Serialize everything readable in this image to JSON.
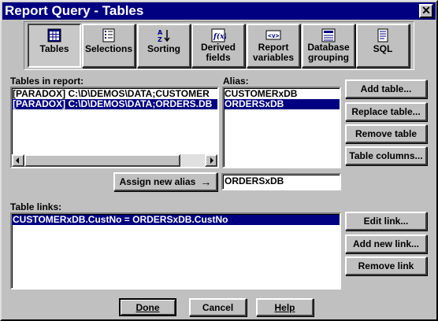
{
  "window": {
    "title": "Report Query - Tables",
    "close_glyph": "✕"
  },
  "toolbar": [
    {
      "label": "Tables",
      "icon": "table-grid-icon",
      "pressed": true
    },
    {
      "label": "Selections",
      "icon": "selection-list-icon"
    },
    {
      "label": "Sorting",
      "icon": "sort-az-icon"
    },
    {
      "label": "Derived\nfields",
      "icon": "formula-icon"
    },
    {
      "label": "Report\nvariables",
      "icon": "variable-icon"
    },
    {
      "label": "Database\ngrouping",
      "icon": "database-grouping-icon"
    },
    {
      "label": "SQL",
      "icon": "sql-document-icon"
    }
  ],
  "tables": {
    "label": "Tables in report:",
    "rows": [
      "[PARADOX] C:\\D\\DEMOS\\DATA;CUSTOMER",
      "[PARADOX] C:\\D\\DEMOS\\DATA;ORDERS.DB"
    ]
  },
  "alias": {
    "label": "Alias:",
    "rows": [
      "CUSTOMERxDB",
      "ORDERSxDB"
    ],
    "input_value": "ORDERSxDB"
  },
  "table_buttons": {
    "add": "Add table...",
    "replace": "Replace table...",
    "remove": "Remove table",
    "columns": "Table columns..."
  },
  "assign_button": "Assign new alias",
  "assign_arrow": "→",
  "links": {
    "label": "Table links:",
    "rows": [
      "CUSTOMERxDB.CustNo = ORDERSxDB.CustNo"
    ]
  },
  "link_buttons": {
    "edit": "Edit link...",
    "add": "Add new link...",
    "remove": "Remove link"
  },
  "footer": {
    "done": "Done",
    "cancel": "Cancel",
    "help": "Help"
  },
  "colors": {
    "titlebar": "#000080",
    "face": "#c0c0c0",
    "selection": "#000080"
  }
}
